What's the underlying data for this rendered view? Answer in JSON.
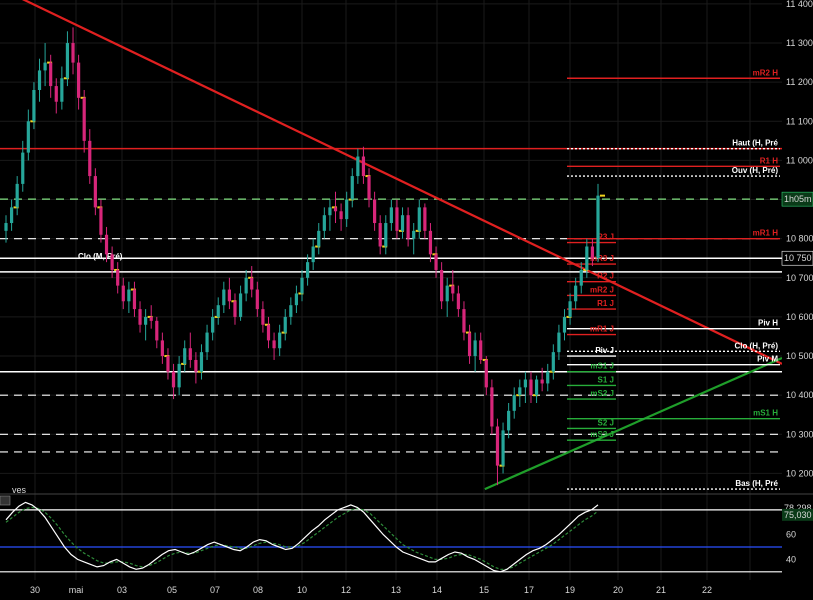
{
  "chart_data": [
    {
      "type": "candlestick",
      "price_axis": {
        "ticks": [
          "11 400",
          "11 300",
          "11 200",
          "11 100",
          "11 000",
          "10 900",
          "10 800",
          "10 700",
          "10 600",
          "10 500",
          "10 400",
          "10 300",
          "10 200"
        ],
        "range": [
          10150,
          11410
        ]
      },
      "date_axis": {
        "ticks": [
          "30",
          "mai",
          "03",
          "05",
          "07",
          "08",
          "10",
          "12",
          "13",
          "14",
          "15",
          "17",
          "19",
          "20",
          "21",
          "22"
        ]
      },
      "price_badges": [
        {
          "text": "1h05m",
          "price": 10901,
          "color": "#2ecc71"
        },
        {
          "text": "10 750",
          "price": 10750,
          "color": "#ffffff"
        }
      ],
      "levels": [
        {
          "label": "mR2 H",
          "price": 11210,
          "color": "#e02020",
          "style": "solid"
        },
        {
          "label": "Haut (H, Pré",
          "price": 11030,
          "color": "#ffffff",
          "style": "dotted"
        },
        {
          "label": "R1 H",
          "price": 10985,
          "color": "#e02020",
          "style": "solid"
        },
        {
          "label": "Ouv (H, Pré)",
          "price": 10960,
          "color": "#ffffff",
          "style": "dotted"
        },
        {
          "label": "mR1 H",
          "price": 10800,
          "color": "#e02020",
          "style": "solid"
        },
        {
          "label": "R3 J",
          "price": 10790,
          "color": "#e02020",
          "style": "short"
        },
        {
          "label": "mR3 J",
          "price": 10735,
          "color": "#e02020",
          "style": "short"
        },
        {
          "label": "R2 J",
          "price": 10690,
          "color": "#e02020",
          "style": "short"
        },
        {
          "label": "mR2 J",
          "price": 10655,
          "color": "#e02020",
          "style": "short"
        },
        {
          "label": "R1 J",
          "price": 10620,
          "color": "#e02020",
          "style": "short"
        },
        {
          "label": "Piv H",
          "price": 10570,
          "color": "#ffffff",
          "style": "solid"
        },
        {
          "label": "mR1 J",
          "price": 10555,
          "color": "#e02020",
          "style": "short"
        },
        {
          "label": "Clo (H, Pré)",
          "price": 10512,
          "color": "#ffffff",
          "style": "dotted"
        },
        {
          "label": "Piv J",
          "price": 10500,
          "color": "#ffffff",
          "style": "short"
        },
        {
          "label": "Piv M",
          "price": 10478,
          "color": "#ffffff",
          "style": "solid"
        },
        {
          "label": "mS1 J",
          "price": 10460,
          "color": "#27ae3a",
          "style": "short"
        },
        {
          "label": "S1 J",
          "price": 10425,
          "color": "#27ae3a",
          "style": "short"
        },
        {
          "label": "mS2 J",
          "price": 10390,
          "color": "#27ae3a",
          "style": "short"
        },
        {
          "label": "mS1 H",
          "price": 10340,
          "color": "#27ae3a",
          "style": "solid"
        },
        {
          "label": "S2 J",
          "price": 10315,
          "color": "#27ae3a",
          "style": "short"
        },
        {
          "label": "mS3 J",
          "price": 10285,
          "color": "#27ae3a",
          "style": "short"
        },
        {
          "label": "Bas (H, Pré",
          "price": 10160,
          "color": "#ffffff",
          "style": "dotted"
        }
      ],
      "left_labels": [
        {
          "label": "Clo (M, Pré)",
          "price": 10740
        }
      ],
      "horizontal_lines": [
        {
          "price": 11030,
          "color": "#e02020",
          "style": "solid"
        },
        {
          "price": 10901,
          "color": "#7fe07f",
          "style": "dashed"
        },
        {
          "price": 10800,
          "color": "#ffffff",
          "style": "dashed"
        },
        {
          "price": 10750,
          "color": "#ffffff",
          "style": "solid"
        },
        {
          "price": 10715,
          "color": "#ffffff",
          "style": "solid"
        },
        {
          "price": 10460,
          "color": "#ffffff",
          "style": "solid"
        },
        {
          "price": 10400,
          "color": "#ffffff",
          "style": "dashed"
        },
        {
          "price": 10300,
          "color": "#ffffff",
          "style": "dashed"
        },
        {
          "price": 10255,
          "color": "#ffffff",
          "style": "dashed"
        }
      ],
      "trendlines": [
        {
          "color": "#e02020",
          "from": [
            0,
            11440
          ],
          "to": [
            1,
            10480
          ]
        },
        {
          "color": "#1f9e2a",
          "from": [
            0.62,
            10160
          ],
          "to": [
            1,
            10495
          ]
        }
      ],
      "candles": [
        [
          10820,
          10860,
          10790,
          10840
        ],
        [
          10840,
          10900,
          10820,
          10880
        ],
        [
          10880,
          10960,
          10860,
          10940
        ],
        [
          10940,
          11050,
          10920,
          11020
        ],
        [
          11020,
          11130,
          11000,
          11100
        ],
        [
          11100,
          11200,
          11080,
          11180
        ],
        [
          11180,
          11260,
          11150,
          11230
        ],
        [
          11230,
          11300,
          11190,
          11250
        ],
        [
          11250,
          11270,
          11160,
          11190
        ],
        [
          11190,
          11210,
          11120,
          11150
        ],
        [
          11150,
          11240,
          11130,
          11210
        ],
        [
          11210,
          11330,
          11190,
          11300
        ],
        [
          11300,
          11340,
          11220,
          11250
        ],
        [
          11250,
          11270,
          11130,
          11160
        ],
        [
          11160,
          11180,
          11020,
          11050
        ],
        [
          11050,
          11080,
          10940,
          10960
        ],
        [
          10960,
          10980,
          10860,
          10880
        ],
        [
          10880,
          10900,
          10790,
          10810
        ],
        [
          10810,
          10830,
          10740,
          10760
        ],
        [
          10760,
          10780,
          10700,
          10720
        ],
        [
          10720,
          10740,
          10660,
          10680
        ],
        [
          10680,
          10700,
          10620,
          10640
        ],
        [
          10640,
          10690,
          10610,
          10670
        ],
        [
          10670,
          10690,
          10600,
          10620
        ],
        [
          10620,
          10640,
          10560,
          10580
        ],
        [
          10580,
          10620,
          10540,
          10600
        ],
        [
          10600,
          10630,
          10570,
          10590
        ],
        [
          10590,
          10600,
          10520,
          10540
        ],
        [
          10540,
          10560,
          10480,
          10500
        ],
        [
          10500,
          10520,
          10440,
          10460
        ],
        [
          10460,
          10480,
          10390,
          10420
        ],
        [
          10420,
          10500,
          10400,
          10480
        ],
        [
          10480,
          10540,
          10460,
          10520
        ],
        [
          10520,
          10560,
          10470,
          10490
        ],
        [
          10490,
          10510,
          10430,
          10460
        ],
        [
          10460,
          10530,
          10440,
          10510
        ],
        [
          10510,
          10580,
          10490,
          10560
        ],
        [
          10560,
          10620,
          10540,
          10600
        ],
        [
          10600,
          10650,
          10580,
          10630
        ],
        [
          10630,
          10690,
          10610,
          10670
        ],
        [
          10670,
          10700,
          10620,
          10640
        ],
        [
          10640,
          10660,
          10580,
          10600
        ],
        [
          10600,
          10680,
          10590,
          10660
        ],
        [
          10660,
          10720,
          10640,
          10700
        ],
        [
          10700,
          10730,
          10650,
          10670
        ],
        [
          10670,
          10690,
          10600,
          10620
        ],
        [
          10620,
          10640,
          10560,
          10580
        ],
        [
          10580,
          10600,
          10520,
          10540
        ],
        [
          10540,
          10560,
          10490,
          10520
        ],
        [
          10520,
          10580,
          10500,
          10560
        ],
        [
          10560,
          10620,
          10540,
          10600
        ],
        [
          10600,
          10650,
          10580,
          10630
        ],
        [
          10630,
          10680,
          10610,
          10660
        ],
        [
          10660,
          10720,
          10640,
          10700
        ],
        [
          10700,
          10760,
          10680,
          10740
        ],
        [
          10740,
          10800,
          10720,
          10780
        ],
        [
          10780,
          10840,
          10760,
          10820
        ],
        [
          10820,
          10880,
          10800,
          10860
        ],
        [
          10860,
          10900,
          10820,
          10880
        ],
        [
          10880,
          10920,
          10840,
          10870
        ],
        [
          10870,
          10890,
          10820,
          10850
        ],
        [
          10850,
          10920,
          10830,
          10900
        ],
        [
          10900,
          10980,
          10880,
          10960
        ],
        [
          10960,
          11030,
          10940,
          11010
        ],
        [
          11010,
          11035,
          10940,
          10960
        ],
        [
          10960,
          10980,
          10880,
          10900
        ],
        [
          10900,
          10920,
          10820,
          10840
        ],
        [
          10840,
          10860,
          10760,
          10780
        ],
        [
          10780,
          10860,
          10760,
          10840
        ],
        [
          10840,
          10900,
          10820,
          10880
        ],
        [
          10880,
          10900,
          10800,
          10820
        ],
        [
          10820,
          10880,
          10800,
          10860
        ],
        [
          10860,
          10880,
          10780,
          10800
        ],
        [
          10800,
          10840,
          10760,
          10820
        ],
        [
          10820,
          10900,
          10800,
          10880
        ],
        [
          10880,
          10890,
          10800,
          10820
        ],
        [
          10820,
          10840,
          10740,
          10760
        ],
        [
          10760,
          10780,
          10700,
          10720
        ],
        [
          10720,
          10740,
          10620,
          10640
        ],
        [
          10640,
          10700,
          10600,
          10680
        ],
        [
          10680,
          10720,
          10640,
          10660
        ],
        [
          10660,
          10680,
          10600,
          10620
        ],
        [
          10620,
          10640,
          10540,
          10560
        ],
        [
          10560,
          10580,
          10480,
          10500
        ],
        [
          10500,
          10560,
          10460,
          10540
        ],
        [
          10540,
          10560,
          10480,
          10490
        ],
        [
          10490,
          10500,
          10400,
          10420
        ],
        [
          10420,
          10440,
          10300,
          10320
        ],
        [
          10320,
          10340,
          10170,
          10220
        ],
        [
          10220,
          10330,
          10200,
          10310
        ],
        [
          10310,
          10380,
          10290,
          10360
        ],
        [
          10360,
          10420,
          10340,
          10400
        ],
        [
          10400,
          10440,
          10370,
          10420
        ],
        [
          10420,
          10460,
          10380,
          10440
        ],
        [
          10440,
          10460,
          10380,
          10400
        ],
        [
          10400,
          10450,
          10380,
          10440
        ],
        [
          10440,
          10470,
          10410,
          10430
        ],
        [
          10430,
          10480,
          10410,
          10460
        ],
        [
          10460,
          10530,
          10440,
          10510
        ],
        [
          10510,
          10580,
          10490,
          10560
        ],
        [
          10560,
          10620,
          10540,
          10600
        ],
        [
          10600,
          10660,
          10580,
          10640
        ],
        [
          10640,
          10700,
          10620,
          10680
        ],
        [
          10680,
          10740,
          10660,
          10720
        ],
        [
          10720,
          10800,
          10700,
          10780
        ],
        [
          10780,
          10800,
          10730,
          10750
        ],
        [
          10750,
          10940,
          10740,
          10910
        ]
      ],
      "oscillator": {
        "ticks": [
          "80",
          "60",
          "40"
        ],
        "range": [
          25,
          92
        ],
        "readouts": [
          {
            "text": "78,298",
            "value": 81.5,
            "color": "#ffffff"
          },
          {
            "text": "75,030",
            "value": 76,
            "color": "#2ecc71"
          }
        ],
        "lines": [
          {
            "value": 80,
            "color": "#ffffff"
          },
          {
            "value": 50,
            "color": "#2a50ff"
          },
          {
            "value": 30,
            "color": "#ffffff"
          }
        ],
        "legend_text": "ves",
        "values": [
          72,
          78,
          83,
          86,
          84,
          80,
          74,
          66,
          58,
          50,
          44,
          40,
          38,
          36,
          34,
          35,
          38,
          40,
          37,
          34,
          32,
          33,
          36,
          40,
          44,
          47,
          48,
          46,
          44,
          46,
          49,
          52,
          54,
          52,
          50,
          48,
          47,
          50,
          54,
          56,
          55,
          52,
          50,
          48,
          49,
          53,
          58,
          63,
          67,
          72,
          76,
          80,
          82,
          84,
          82,
          78,
          72,
          66,
          60,
          55,
          50,
          46,
          44,
          42,
          40,
          38,
          38,
          41,
          44,
          46,
          45,
          42,
          40,
          37,
          34,
          31,
          30,
          32,
          36,
          40,
          44,
          47,
          49,
          52,
          56,
          60,
          65,
          70,
          75,
          78,
          80,
          84
        ],
        "signal": [
          70,
          74,
          78,
          81,
          82,
          81,
          78,
          73,
          67,
          60,
          54,
          49,
          45,
          42,
          39,
          37,
          37,
          38,
          38,
          37,
          35,
          34,
          35,
          37,
          40,
          43,
          45,
          46,
          45,
          45,
          47,
          49,
          51,
          52,
          51,
          50,
          49,
          49,
          51,
          53,
          54,
          53,
          52,
          50,
          50,
          51,
          54,
          58,
          62,
          66,
          70,
          74,
          77,
          80,
          81,
          80,
          77,
          72,
          67,
          62,
          57,
          52,
          49,
          46,
          44,
          42,
          40,
          40,
          41,
          43,
          44,
          44,
          42,
          40,
          37,
          34,
          32,
          32,
          34,
          37,
          40,
          43,
          46,
          49,
          52,
          56,
          60,
          64,
          68,
          72,
          75,
          79
        ]
      },
      "colors": {
        "up": "#26a69a",
        "down": "#d7267a",
        "background": "#000000",
        "grid": "#1a1a1a"
      }
    }
  ]
}
